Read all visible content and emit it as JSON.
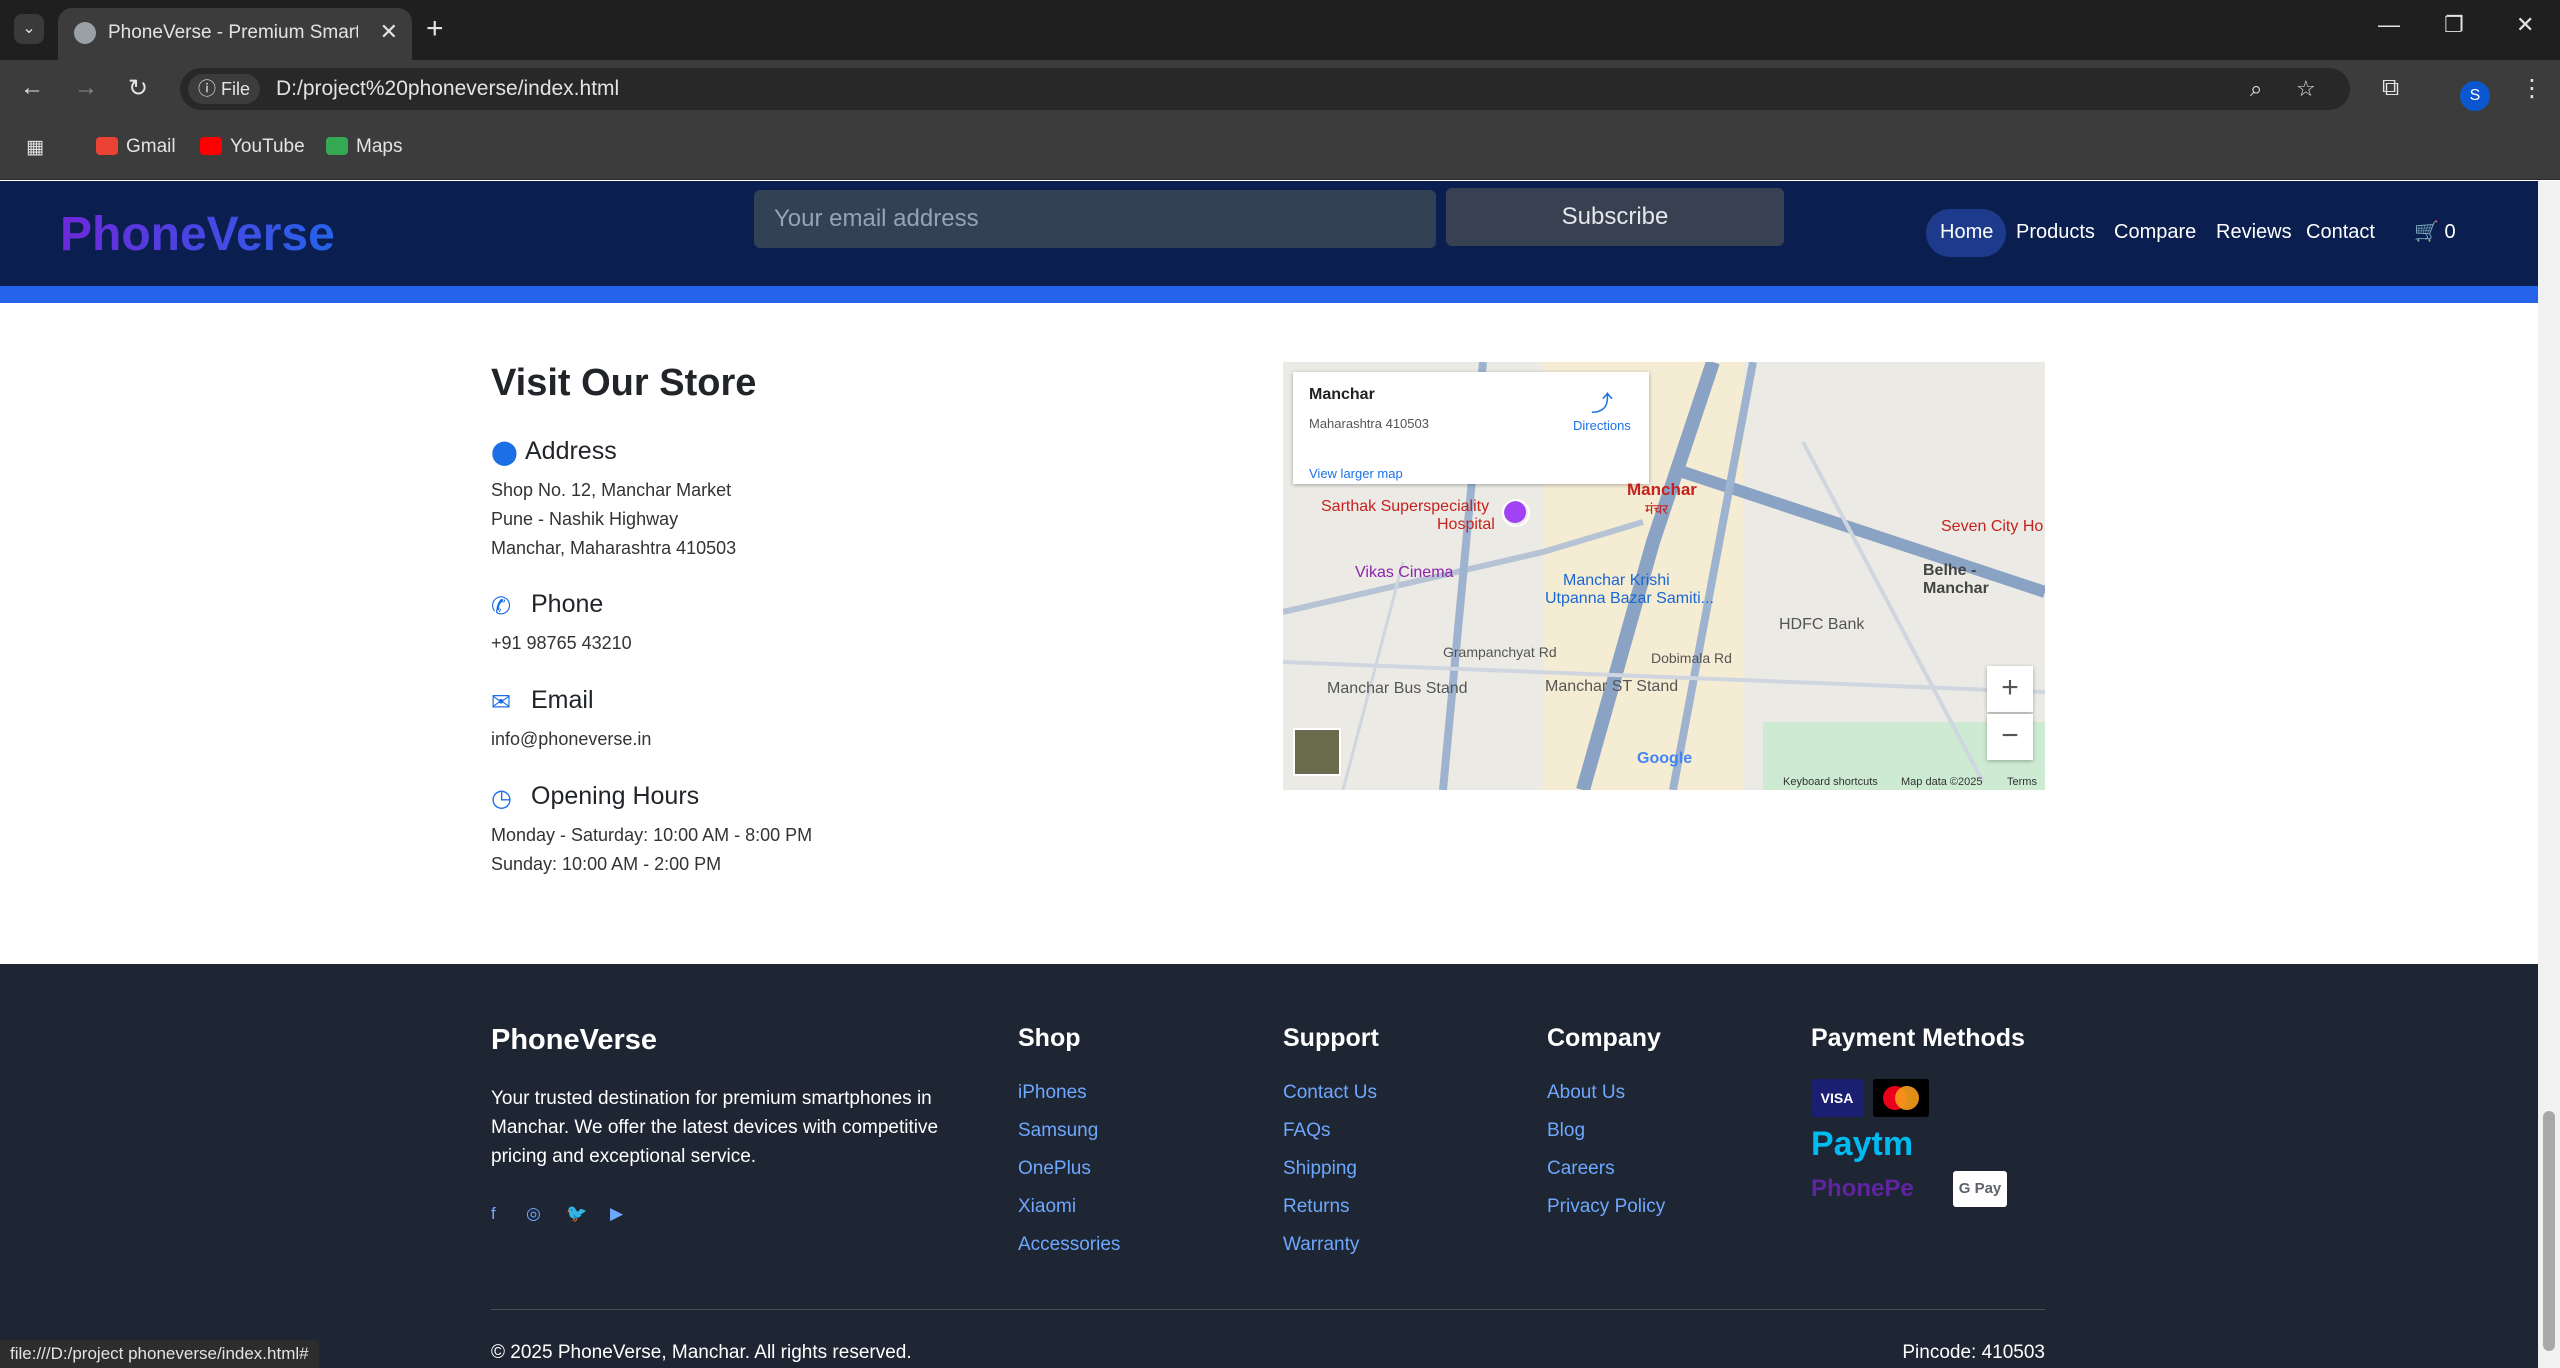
{
  "browser": {
    "tab_title": "PhoneVerse - Premium Smartphones",
    "url_chip": "File",
    "url": "D:/project%20phoneverse/index.html",
    "bookmarks": [
      "Gmail",
      "YouTube",
      "Maps"
    ],
    "profile_initial": "S",
    "status_url": "file:///D:/project phoneverse/index.html#"
  },
  "header": {
    "logo": "PhoneVerse",
    "email_placeholder": "Your email address",
    "subscribe_label": "Subscribe",
    "nav": [
      "Home",
      "Products",
      "Compare",
      "Reviews",
      "Contact"
    ],
    "cart_count": "0"
  },
  "store": {
    "title": "Visit Our Store",
    "address_heading": "Address",
    "address_lines": [
      "Shop No. 12, Manchar Market",
      "Pune - Nashik Highway",
      "Manchar, Maharashtra 410503"
    ],
    "phone_heading": "Phone",
    "phone": "+91 98765 43210",
    "email_heading": "Email",
    "email": "info@phoneverse.in",
    "hours_heading": "Opening Hours",
    "hours_lines": [
      "Monday - Saturday: 10:00 AM - 8:00 PM",
      "Sunday: 10:00 AM - 2:00 PM"
    ]
  },
  "map": {
    "place": "Manchar",
    "place_sub": "Maharashtra 410503",
    "directions": "Directions",
    "larger_map": "View larger map",
    "labels": {
      "manchar": "Manchar",
      "manchar_mr": "मंचर",
      "sarthak": "Sarthak Superspeciality",
      "hospital": "Hospital",
      "seven_city": "Seven City Ho",
      "vikas": "Vikas Cinema",
      "krishi1": "Manchar Krishi",
      "krishi2": "Utpanna Bazar Samiti...",
      "belhe": "Belhe - Manchar",
      "hdfc": "HDFC Bank",
      "grampanchayat": "Grampanchyat Rd",
      "dobimala": "Dobimala Rd",
      "bus_stand": "Manchar Bus Stand",
      "st_stand": "Manchar ST Stand"
    },
    "google": "Google",
    "shortcuts": "Keyboard shortcuts",
    "map_data": "Map data ©2025",
    "terms": "Terms"
  },
  "footer": {
    "brand": "PhoneVerse",
    "description": "Your trusted destination for premium smartphones in Manchar. We offer the latest devices with competitive pricing and exceptional service.",
    "shop_heading": "Shop",
    "shop_links": [
      "iPhones",
      "Samsung",
      "OnePlus",
      "Xiaomi",
      "Accessories"
    ],
    "support_heading": "Support",
    "support_links": [
      "Contact Us",
      "FAQs",
      "Shipping",
      "Returns",
      "Warranty"
    ],
    "company_heading": "Company",
    "company_links": [
      "About Us",
      "Blog",
      "Careers",
      "Privacy Policy"
    ],
    "payment_heading": "Payment Methods",
    "payments": [
      "VISA",
      "Paytm",
      "PhonePe",
      "G Pay"
    ],
    "copyright": "© 2025 PhoneVerse, Manchar. All rights reserved.",
    "pincode": "Pincode: 410503"
  }
}
